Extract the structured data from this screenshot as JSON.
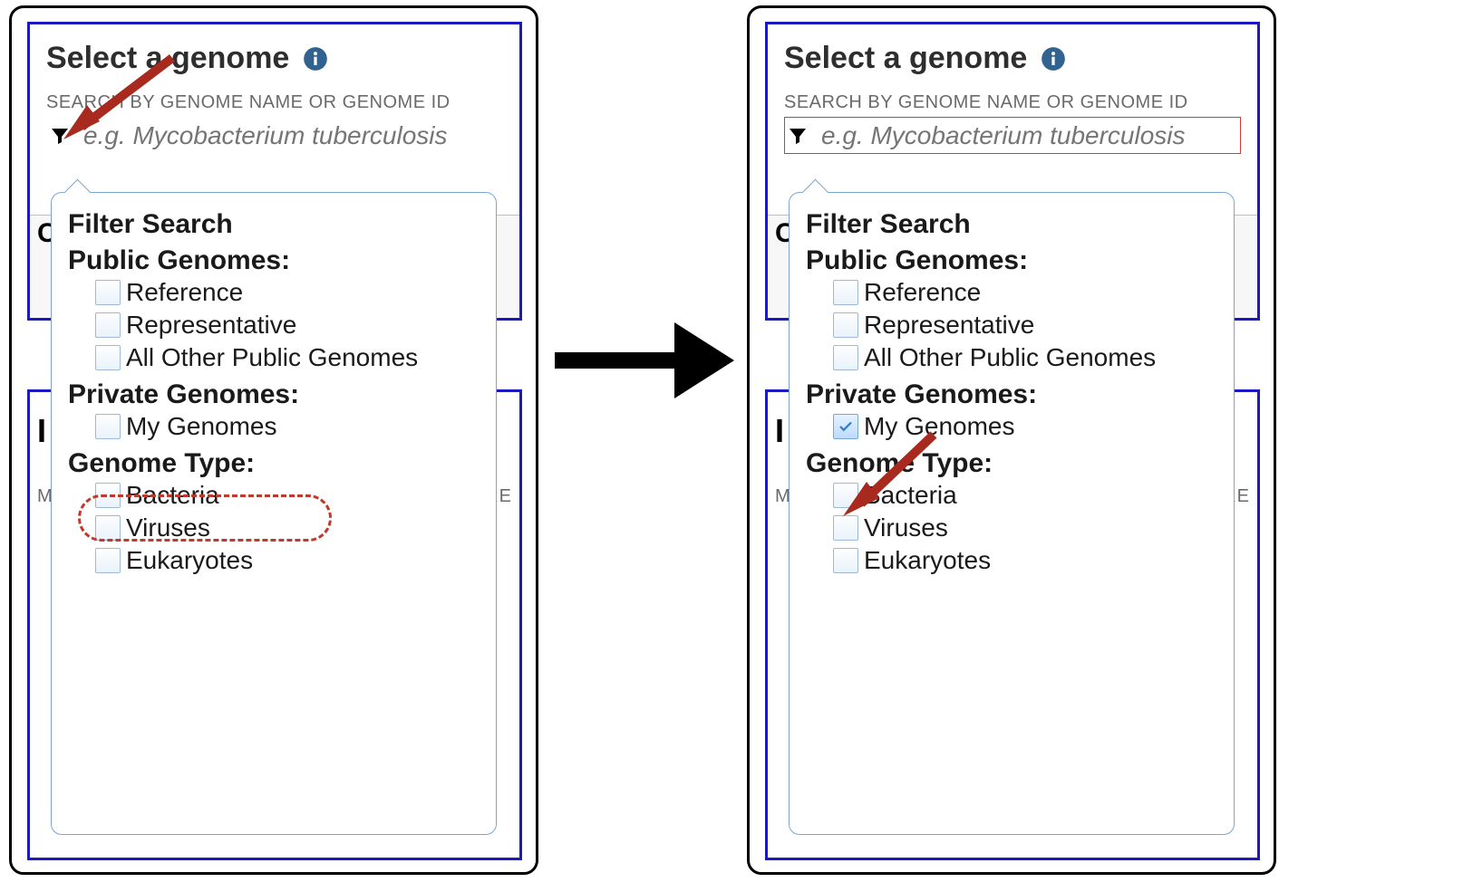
{
  "panels": {
    "left": {
      "title": "Select a genome",
      "search_label": "SEARCH BY GENOME NAME OR GENOME ID",
      "search_placeholder": "e.g. Mycobacterium tuberculosis",
      "truncated": {
        "c": "C",
        "i": "I",
        "m": "M",
        "re": "RE"
      }
    },
    "right": {
      "title": "Select a genome",
      "search_label": "SEARCH BY GENOME NAME OR GENOME ID",
      "search_placeholder": "e.g. Mycobacterium tuberculosis",
      "truncated": {
        "c": "C",
        "i": "I",
        "m": "M",
        "re": "RE"
      }
    }
  },
  "dropdown": {
    "title": "Filter Search",
    "sections": {
      "public": {
        "heading": "Public Genomes:",
        "options": {
          "reference": {
            "label": "Reference",
            "checked_left": false,
            "checked_right": false
          },
          "representative": {
            "label": "Representative",
            "checked_left": false,
            "checked_right": false
          },
          "all_other": {
            "label": "All Other Public Genomes",
            "checked_left": false,
            "checked_right": false
          }
        }
      },
      "private": {
        "heading": "Private Genomes:",
        "options": {
          "my_genomes": {
            "label": "My Genomes",
            "checked_left": false,
            "checked_right": true
          }
        }
      },
      "type": {
        "heading": "Genome Type:",
        "options": {
          "bacteria": {
            "label": "Bacteria",
            "checked_left": false,
            "checked_right": false
          },
          "viruses": {
            "label": "Viruses",
            "checked_left": false,
            "checked_right": false
          },
          "eukaryotes": {
            "label": "Eukaryotes",
            "checked_left": false,
            "checked_right": false
          }
        }
      }
    }
  },
  "icons": {
    "info": "info-icon",
    "funnel": "funnel-icon"
  }
}
